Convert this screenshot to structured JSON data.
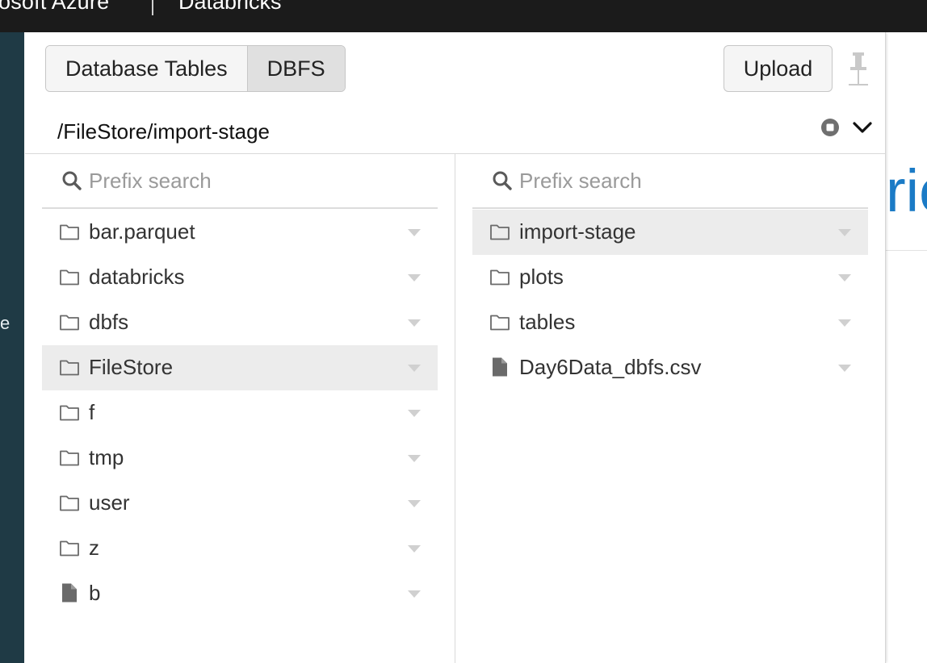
{
  "topbar": {
    "brand": "osoft Azure",
    "product": "Databricks"
  },
  "leftnav": {
    "peek_text": "e"
  },
  "background_page": {
    "peek_text": "ric"
  },
  "tabs": [
    {
      "label": "Database Tables",
      "active": false
    },
    {
      "label": "DBFS",
      "active": true
    }
  ],
  "upload_label": "Upload",
  "path": "/FileStore/import-stage",
  "left_pane": {
    "search_placeholder": "Prefix search",
    "items": [
      {
        "name": "bar.parquet",
        "type": "folder",
        "selected": false
      },
      {
        "name": "databricks",
        "type": "folder",
        "selected": false
      },
      {
        "name": "dbfs",
        "type": "folder",
        "selected": false
      },
      {
        "name": "FileStore",
        "type": "folder",
        "selected": true
      },
      {
        "name": "f",
        "type": "folder",
        "selected": false
      },
      {
        "name": "tmp",
        "type": "folder",
        "selected": false
      },
      {
        "name": "user",
        "type": "folder",
        "selected": false
      },
      {
        "name": "z",
        "type": "folder",
        "selected": false
      },
      {
        "name": "b",
        "type": "file",
        "selected": false
      }
    ]
  },
  "right_pane": {
    "search_placeholder": "Prefix search",
    "items": [
      {
        "name": "import-stage",
        "type": "folder",
        "selected": true
      },
      {
        "name": "plots",
        "type": "folder",
        "selected": false
      },
      {
        "name": "tables",
        "type": "folder",
        "selected": false
      },
      {
        "name": "Day6Data_dbfs.csv",
        "type": "file",
        "selected": false
      }
    ]
  },
  "colors": {
    "topbar": "#1b1b1b",
    "sidebar": "#1f3a45",
    "selected_row": "#ececec",
    "accent_blue": "#1b7bc6"
  }
}
